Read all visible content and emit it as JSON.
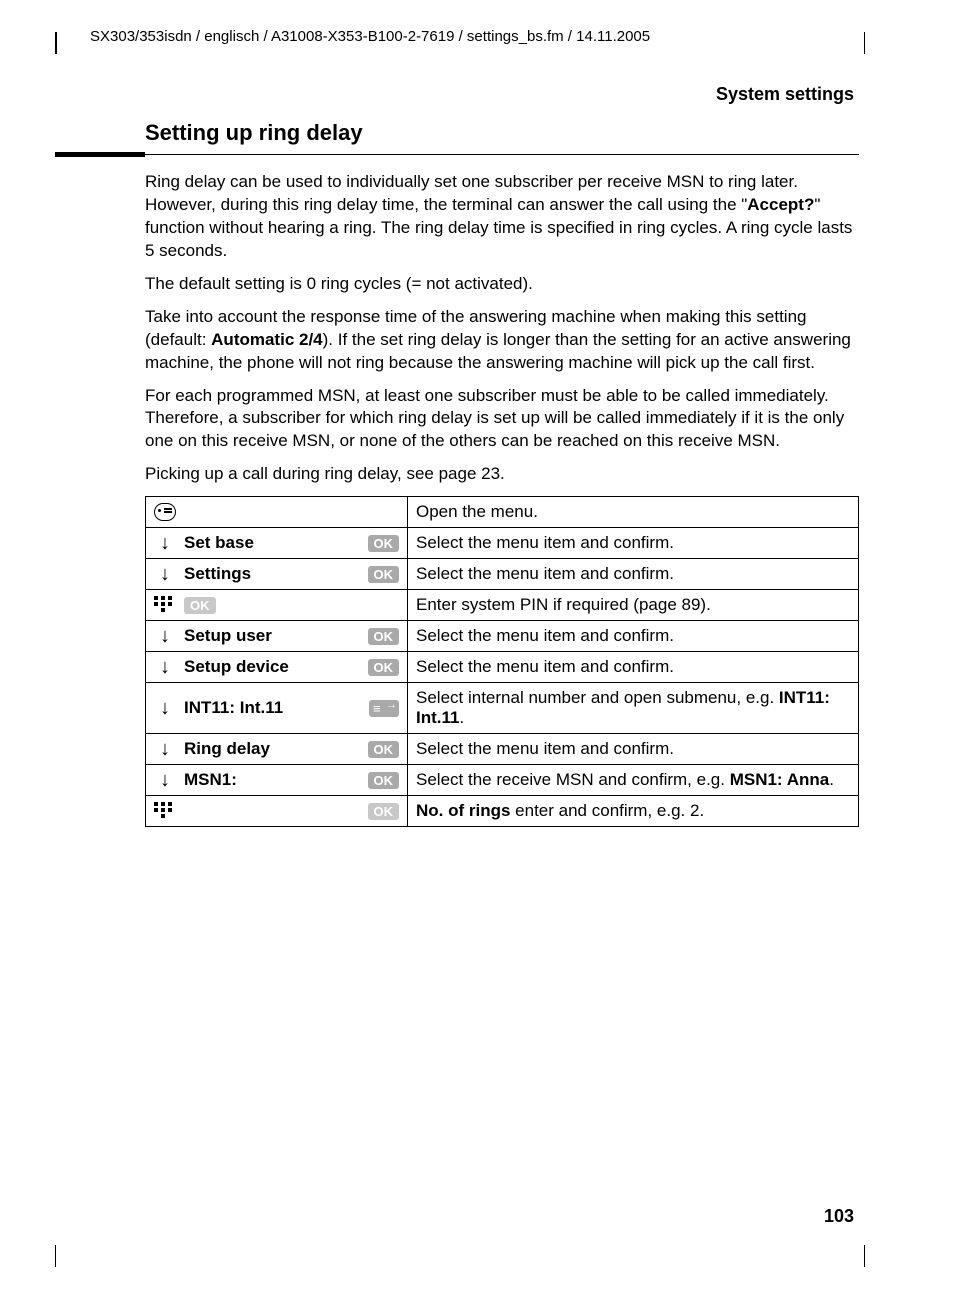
{
  "header_path": "SX303/353isdn / englisch / A31008-X353-B100-2-7619 / settings_bs.fm / 14.11.2005",
  "section_label": "System settings",
  "title": "Setting up ring delay",
  "paragraphs": {
    "p1a": "Ring delay can be used to individually set one subscriber per receive MSN to ring later. However, during this ring delay time, the terminal can answer the call using the \"",
    "p1b": "Accept?",
    "p1c": "\" function without hearing a ring. The ring delay time is specified in ring cycles. A ring cycle lasts 5 seconds.",
    "p2": "The default setting is 0 ring cycles (= not activated).",
    "p3a": "Take into account the response time of the answering machine when making this setting (default: ",
    "p3b": "Automatic 2/4",
    "p3c": "). If the set ring delay is longer than the setting for an active answering machine, the phone will not ring because the answering machine will pick up the call first.",
    "p4": "For each programmed MSN, at least one subscriber must be able to be called immediately. Therefore, a subscriber for which ring delay is set up will be called immediately if it is the only one on this receive MSN, or none of the others can be reached on this receive MSN.",
    "p5": "Picking up a call during ring delay, see page 23."
  },
  "ok_label": "OK",
  "rows": {
    "r0": {
      "desc": "Open the menu."
    },
    "r1": {
      "label": "Set base",
      "desc": "Select the menu item and confirm."
    },
    "r2": {
      "label": "Settings",
      "desc": "Select the menu item and confirm."
    },
    "r3": {
      "desc": "Enter system PIN if required (page 89)."
    },
    "r4": {
      "label": "Setup user",
      "desc": "Select the menu item and confirm."
    },
    "r5": {
      "label": "Setup device",
      "desc": "Select the menu item and confirm."
    },
    "r6": {
      "label": "INT11: Int.11",
      "desc_a": "Select internal number and open submenu, e.g. ",
      "desc_b": "INT11: Int.11",
      "desc_c": "."
    },
    "r7": {
      "label": "Ring delay",
      "desc": "Select the menu item and confirm."
    },
    "r8": {
      "label": "MSN1:",
      "desc_a": "Select the receive MSN and confirm, e.g. ",
      "desc_b": "MSN1: Anna",
      "desc_c": "."
    },
    "r9": {
      "desc_a": "No. of rings",
      "desc_b": " enter and confirm, e.g. 2."
    }
  },
  "page_number": "103"
}
